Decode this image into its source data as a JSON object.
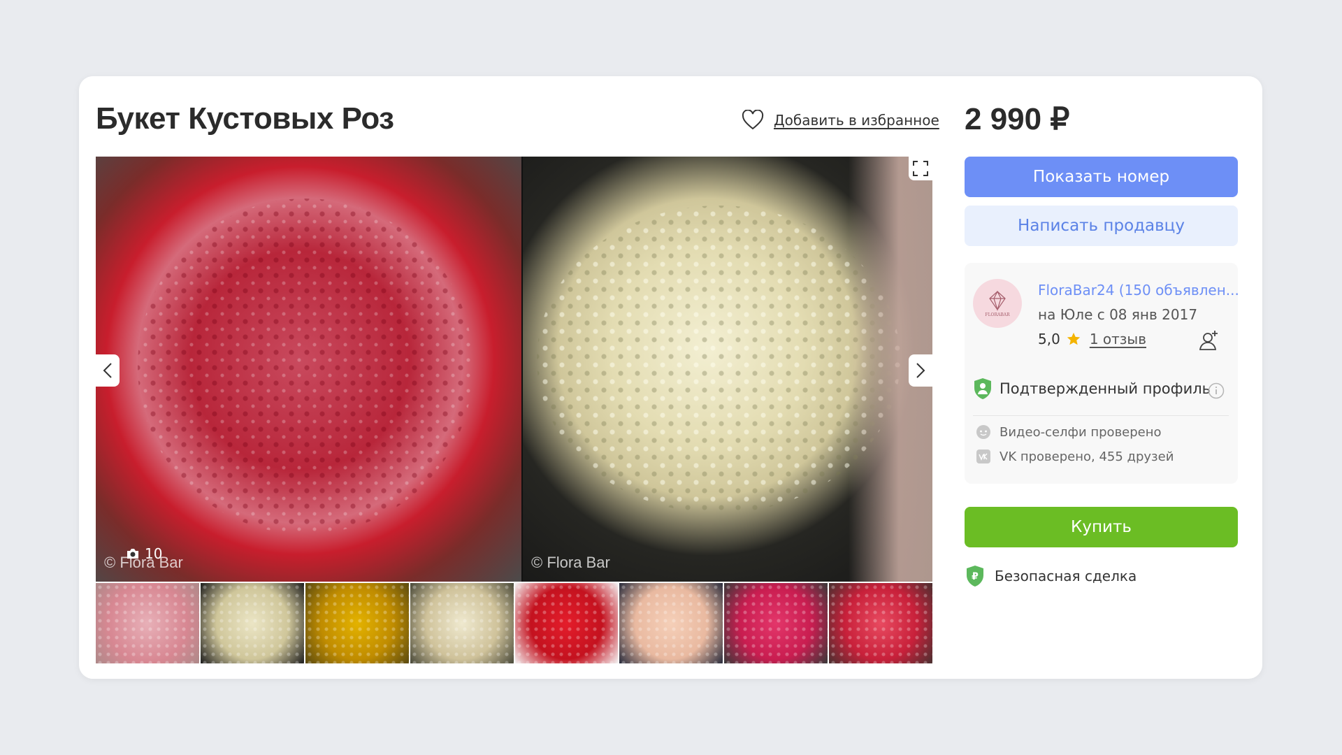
{
  "listing": {
    "title": "Букет Кустовых Роз",
    "favorite_label": "Добавить в избранное",
    "price": "2 990 ₽"
  },
  "gallery": {
    "photo_count": "10",
    "watermark": "© Flora Bar",
    "thumbnail_count": 8
  },
  "actions": {
    "show_phone": "Показать номер",
    "write_seller": "Написать продавцу",
    "buy": "Купить"
  },
  "seller": {
    "name": "FloraBar24 (150 объявлен...",
    "since": "на Юле с 08 янв 2017",
    "rating": "5,0",
    "reviews": "1 отзыв",
    "logo_text": "FLORABAR",
    "verified_label": "Подтвержденный профиль",
    "checks": [
      {
        "label": "Видео-селфи проверено",
        "icon": "selfie-icon"
      },
      {
        "label": "VK проверено, 455 друзей",
        "icon": "vk-icon"
      }
    ]
  },
  "safe_deal": {
    "label": "Безопасная сделка"
  },
  "colors": {
    "primary_blue": "#6d8ff6",
    "light_blue": "#e9f0fd",
    "buy_green": "#6bbd24",
    "verified_green": "#5cb85c",
    "star": "#f4b400",
    "background": "#e9ebef"
  }
}
